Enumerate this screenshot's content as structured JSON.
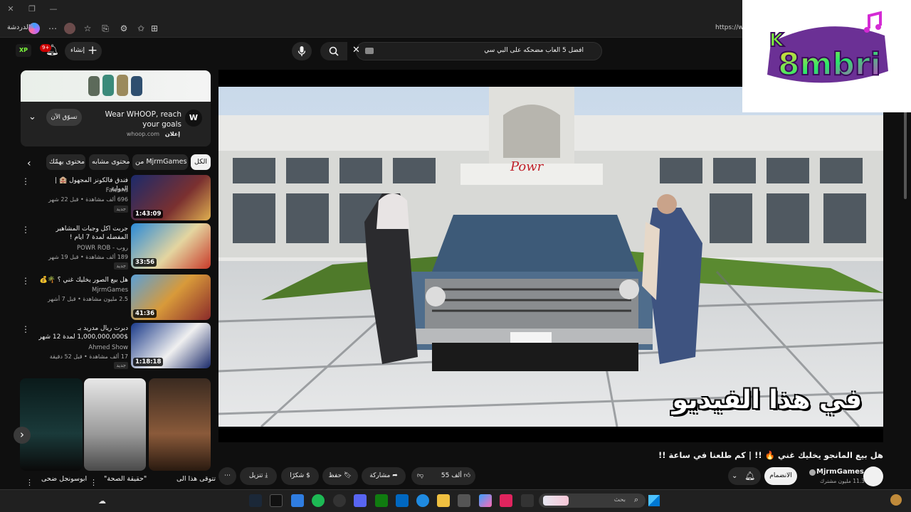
{
  "browser": {
    "tab_label": "الدردشة",
    "url_fragment": "https://w"
  },
  "youtube": {
    "notification_count": "9+",
    "create_label": "إنشاء",
    "search_query": "افضل 5 العاب مضحكه على البي سي"
  },
  "ad": {
    "title": "Wear WHOOP, reach your goals",
    "domain": "whoop.com",
    "sponsored": "إعلان",
    "cta": "تسوّق الآن"
  },
  "chips": [
    "الكل",
    "من MjrmGames",
    "محتوى مشابه",
    "محتوى يهمّك"
  ],
  "related": [
    {
      "title": "فندق فالكونز المجهول 🏨 | الدولية",
      "channel": "Falcons",
      "meta": "696 ألف مشاهدة • قبل 22 شهر",
      "badge": "جديد",
      "duration": "1:43:09"
    },
    {
      "title": "جربت اكل وجبات المشاهير المفضله لمدة 7 ايام !",
      "channel": "روب - POWR ROB",
      "meta": "189 ألف مشاهدة • قبل 19 شهر",
      "badge": "جديد",
      "duration": "33:56"
    },
    {
      "title": "هل بيع الصور يخليك غني ؟ 🌴💰",
      "channel": "MjrmGames",
      "meta": "2.5 مليون مشاهدة • قبل 7 أشهر",
      "badge": "",
      "duration": "41:36"
    },
    {
      "title": "دبرت ريال مدريد بـ $1,000,000,000 لمدة 12 شهر",
      "channel": "Ahmed Show",
      "meta": "17 ألف مشاهدة • قبل 52 دقيقة",
      "badge": "جديد",
      "duration": "1:18:18"
    }
  ],
  "shorts": [
    {
      "title": "تتوقى هذا الى"
    },
    {
      "title": "\"حقيقة الصحة\""
    },
    {
      "title": "ابوسونجل ضحى"
    }
  ],
  "video": {
    "title": "هل بيع المانجو يخليك غني 🔥 !! | كم طلعنا في ساعة !!",
    "caption": "في هذا الفيديو",
    "plate": "6025 LEA",
    "sign": "Powr"
  },
  "channel": {
    "name": "MjrmGames",
    "subs": "11.3 مليون مشترك",
    "join": "الانضمام"
  },
  "actions": {
    "likes": "55 ألف",
    "share": "مشاركة",
    "save": "حفظ",
    "thanks": "شكرًا",
    "download": "تنزيل"
  },
  "taskbar": {
    "search_placeholder": "بحث"
  },
  "logo": {
    "text": "8mbri",
    "letter": "K"
  }
}
